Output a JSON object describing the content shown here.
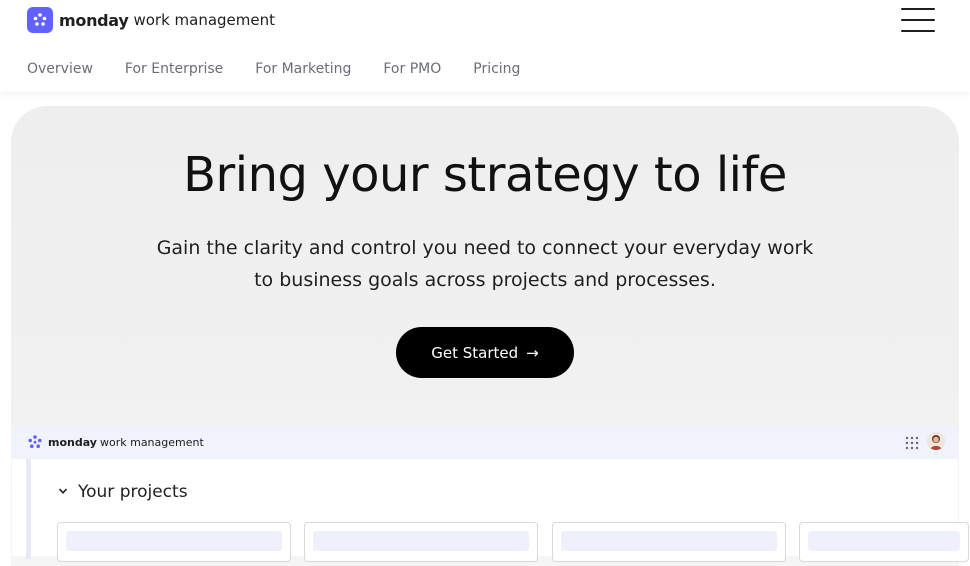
{
  "header": {
    "brand_name": "monday",
    "brand_sub": "work management",
    "nav": [
      "Overview",
      "For Enterprise",
      "For Marketing",
      "For PMO",
      "Pricing"
    ]
  },
  "hero": {
    "title": "Bring your strategy to life",
    "text": "Gain the clarity and control you need to connect your everyday work to business goals across projects and processes.",
    "cta_label": "Get Started",
    "cta_arrow": "→"
  },
  "preview": {
    "brand_name": "monday",
    "brand_sub": "work management",
    "section_title": "Your projects",
    "chevron": "⌄"
  },
  "colors": {
    "brand": "#6161ff",
    "cta_bg": "#000000",
    "hero_bg": "#eeeeee"
  }
}
